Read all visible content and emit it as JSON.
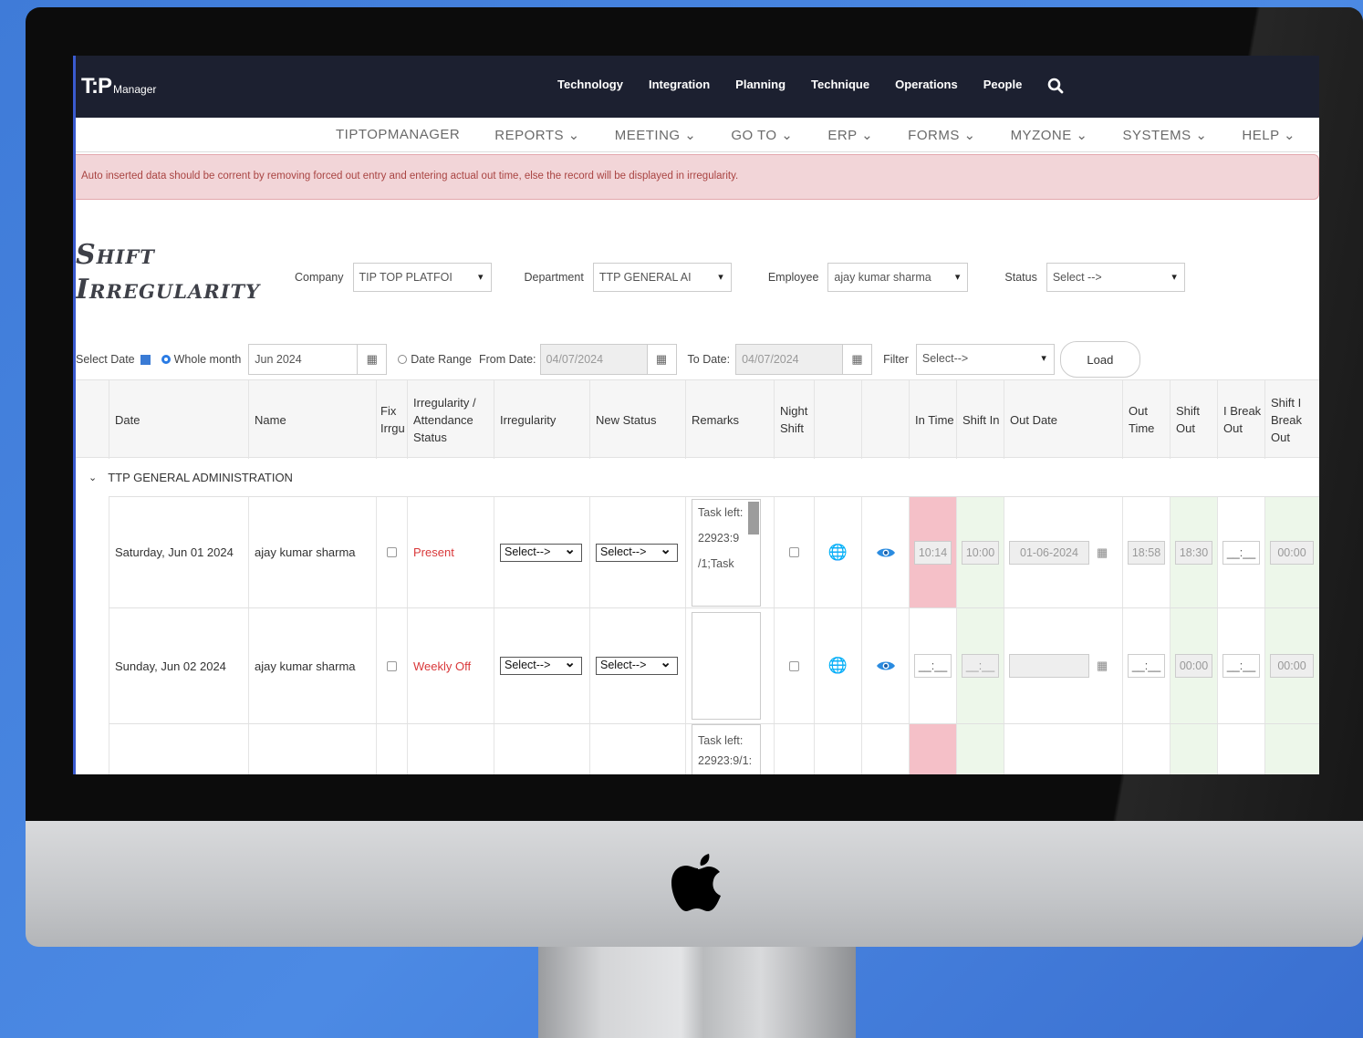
{
  "app": {
    "logo_text": "T:P",
    "logo_sub": "Manager"
  },
  "topnav": [
    "Technology",
    "Integration",
    "Planning",
    "Technique",
    "Operations",
    "People"
  ],
  "menubar": [
    "TIPTOPMANAGER",
    "REPORTS ⌄",
    "MEETING ⌄",
    "GO TO ⌄",
    "ERP ⌄",
    "FORMS ⌄",
    "MYZONE ⌄",
    "SYSTEMS ⌄",
    "HELP ⌄"
  ],
  "alert": "Auto inserted data should be corrent by removing forced out entry and entering actual out time, else the record will be displayed in irregularity.",
  "page_title": {
    "line1": "Shift",
    "line2": "Irregularity"
  },
  "filters": {
    "company_label": "Company",
    "company_value": "TIP TOP PLATFOI",
    "department_label": "Department",
    "department_value": "TTP GENERAL AI",
    "employee_label": "Employee",
    "employee_value": "ajay kumar sharma",
    "status_label": "Status",
    "status_value": "Select -->"
  },
  "daterow": {
    "select_date_label": "Select Date",
    "whole_month_label": "Whole month",
    "month_value": "Jun 2024",
    "date_range_label": "Date Range",
    "from_label": "From Date:",
    "from_value": "04/07/2024",
    "to_label": "To Date:",
    "to_value": "04/07/2024",
    "filter_label": "Filter",
    "filter_value": "Select-->",
    "load_label": "Load"
  },
  "columns": [
    "Date",
    "Name",
    "Fix Irrgu",
    "Irregularity / Attendance Status",
    "Irregularity",
    "New Status",
    "Remarks",
    "Night Shift",
    "In Time",
    "Shift In",
    "Out Date",
    "Out Time",
    "Shift Out",
    "I Break Out",
    "Shift I Break Out"
  ],
  "group_name": "TTP GENERAL ADMINISTRATION",
  "rows": [
    {
      "date": "Saturday, Jun 01 2024",
      "name": "ajay kumar sharma",
      "status": "Present",
      "irregularity": "Select-->",
      "new_status": "Select-->",
      "remarks": "Task left: 22923:9 /1;Task",
      "in_time": "10:14",
      "shift_in": "10:00",
      "out_date": "01-06-2024",
      "out_time": "18:58",
      "shift_out": "18:30",
      "break_out": "__:__",
      "shift_break_out": "00:00"
    },
    {
      "date": "Sunday, Jun 02 2024",
      "name": "ajay kumar sharma",
      "status": "Weekly Off",
      "irregularity": "Select-->",
      "new_status": "Select-->",
      "remarks": "",
      "in_time": "__:__",
      "shift_in": "__:__",
      "out_date": "",
      "out_time": "__:__",
      "shift_out": "00:00",
      "break_out": "__:__",
      "shift_break_out": "00:00"
    },
    {
      "remarks": "Task left: 22923:9/1:"
    }
  ]
}
